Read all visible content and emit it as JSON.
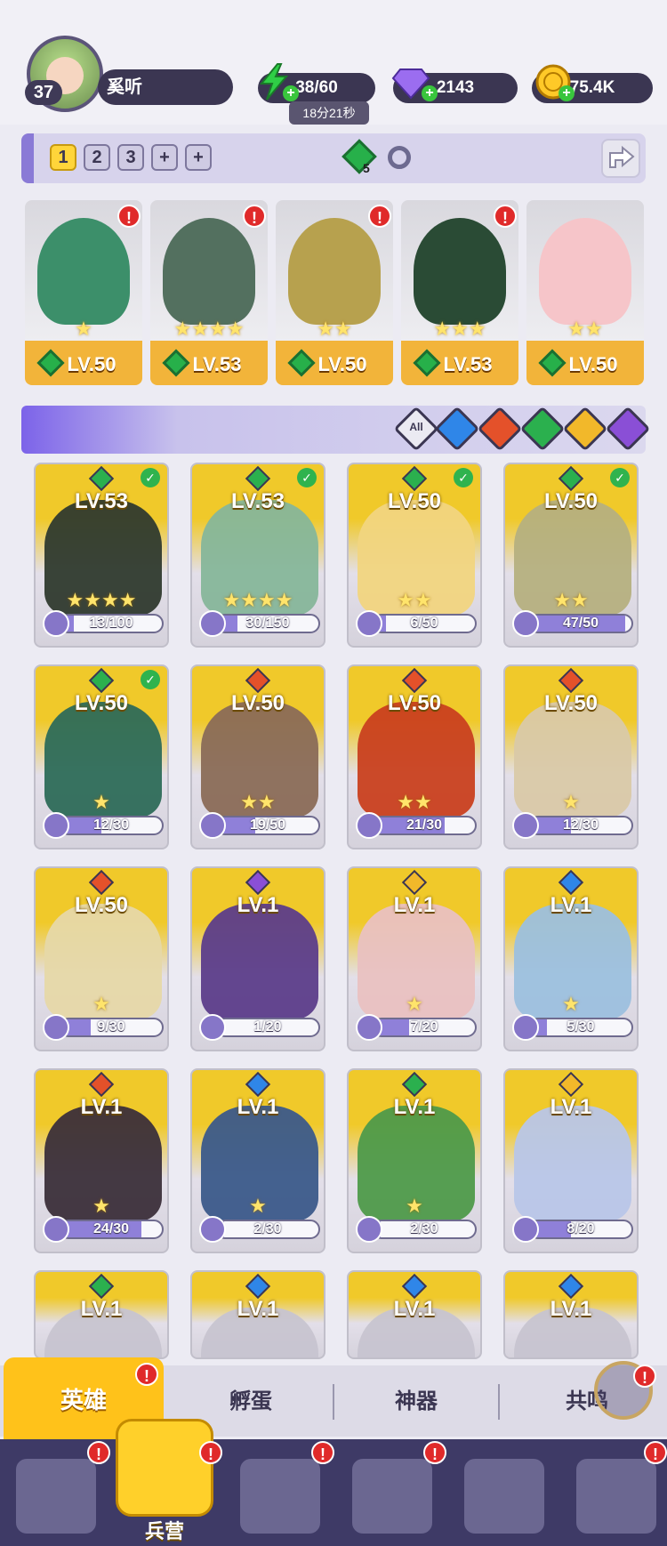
{
  "player": {
    "level": "37",
    "name": "奚听"
  },
  "resources": {
    "energy": {
      "value": "38/60",
      "icon": "lightning-icon",
      "timer": "18分21秒"
    },
    "gems": {
      "value": "2143",
      "icon": "diamond-icon"
    },
    "coins": {
      "value": "75.4K",
      "icon": "coin-icon"
    }
  },
  "teams": {
    "tabs": [
      {
        "label": "1",
        "active": true
      },
      {
        "label": "2"
      },
      {
        "label": "3"
      },
      {
        "label": "+"
      },
      {
        "label": "+"
      }
    ],
    "gem_badge": "5"
  },
  "team_heroes": [
    {
      "level": "LV.50",
      "stars": "★",
      "color": "#3c8f6a"
    },
    {
      "level": "LV.53",
      "stars": "★★★★",
      "color": "#53705f"
    },
    {
      "level": "LV.50",
      "stars": "★★",
      "color": "#b7a14e"
    },
    {
      "level": "LV.53",
      "stars": "★★★",
      "color": "#2a4b35"
    },
    {
      "level": "LV.50",
      "stars": "★★",
      "color": "#f6c5c9"
    }
  ],
  "filters": [
    {
      "label": "All",
      "color": "#ebeaf2"
    },
    {
      "name": "water",
      "color": "#2f86e8"
    },
    {
      "name": "fire",
      "color": "#e4512a"
    },
    {
      "name": "wood",
      "color": "#2bb04e"
    },
    {
      "name": "light",
      "color": "#f2b82a"
    },
    {
      "name": "dark",
      "color": "#8a4fd6"
    }
  ],
  "heroes": [
    {
      "level": "LV.53",
      "stars": "★★★★",
      "progress": "13/100",
      "pct": 0.13,
      "element": "#2bb04e",
      "check": true,
      "art": "#2f3a2e"
    },
    {
      "level": "LV.53",
      "stars": "★★★★",
      "progress": "30/150",
      "pct": 0.2,
      "element": "#2bb04e",
      "check": true,
      "art": "#86b69a"
    },
    {
      "level": "LV.50",
      "stars": "★★",
      "progress": "6/50",
      "pct": 0.12,
      "element": "#2bb04e",
      "check": true,
      "art": "#f1d580"
    },
    {
      "level": "LV.50",
      "stars": "★★",
      "progress": "47/50",
      "pct": 0.94,
      "element": "#2bb04e",
      "check": true,
      "art": "#b5b080"
    },
    {
      "level": "LV.50",
      "stars": "★",
      "progress": "12/30",
      "pct": 0.4,
      "element": "#2bb04e",
      "check": true,
      "art": "#2d6b58"
    },
    {
      "level": "LV.50",
      "stars": "★★",
      "progress": "19/50",
      "pct": 0.38,
      "element": "#e4512a",
      "check": false,
      "art": "#8a6b57"
    },
    {
      "level": "LV.50",
      "stars": "★★",
      "progress": "21/30",
      "pct": 0.7,
      "element": "#e4512a",
      "check": false,
      "art": "#c9401f"
    },
    {
      "level": "LV.50",
      "stars": "★",
      "progress": "12/30",
      "pct": 0.4,
      "element": "#e4512a",
      "check": false,
      "art": "#d9c9a8"
    },
    {
      "level": "LV.50",
      "stars": "★",
      "progress": "9/30",
      "pct": 0.3,
      "element": "#e4512a",
      "check": false,
      "art": "#e6d8a8"
    },
    {
      "level": "LV.1",
      "stars": "",
      "progress": "1/20",
      "pct": 0.05,
      "element": "#8a4fd6",
      "check": false,
      "art": "#5c3d8a"
    },
    {
      "level": "LV.1",
      "stars": "★",
      "progress": "7/20",
      "pct": 0.35,
      "element": "#f2b82a",
      "check": false,
      "art": "#e9c1c1"
    },
    {
      "level": "LV.1",
      "stars": "★",
      "progress": "5/30",
      "pct": 0.17,
      "element": "#2f86e8",
      "check": false,
      "art": "#9cc0de"
    },
    {
      "level": "LV.1",
      "stars": "★",
      "progress": "24/30",
      "pct": 0.8,
      "element": "#e4512a",
      "check": false,
      "art": "#3b2f3a"
    },
    {
      "level": "LV.1",
      "stars": "★",
      "progress": "2/30",
      "pct": 0.07,
      "element": "#2f86e8",
      "check": false,
      "art": "#3b5a8a"
    },
    {
      "level": "LV.1",
      "stars": "★",
      "progress": "2/30",
      "pct": 0.07,
      "element": "#2bb04e",
      "check": false,
      "art": "#4e9a4a"
    },
    {
      "level": "LV.1",
      "stars": "",
      "progress": "8/20",
      "pct": 0.4,
      "element": "#f2b82a",
      "check": false,
      "art": "#b8c6e8"
    },
    {
      "level": "LV.1",
      "stars": "",
      "progress": "",
      "pct": 0,
      "element": "#2bb04e",
      "check": false,
      "art": "#c7c4d0"
    },
    {
      "level": "LV.1",
      "stars": "",
      "progress": "",
      "pct": 0,
      "element": "#2f86e8",
      "check": false,
      "art": "#c7c4d0"
    },
    {
      "level": "LV.1",
      "stars": "",
      "progress": "",
      "pct": 0,
      "element": "#2f86e8",
      "check": false,
      "art": "#c7c4d0"
    },
    {
      "level": "LV.1",
      "stars": "",
      "progress": "",
      "pct": 0,
      "element": "#2f86e8",
      "check": false,
      "art": "#c7c4d0"
    }
  ],
  "subtabs": [
    {
      "label": "英雄",
      "active": true
    },
    {
      "label": "孵蛋"
    },
    {
      "label": "神器"
    },
    {
      "label": "共鸣"
    }
  ],
  "nav": {
    "active_label": "兵营",
    "icons": [
      "cards-icon",
      "barracks-icon",
      "map-icon",
      "castle-icon",
      "mushroom-icon",
      "banner-icon"
    ]
  }
}
